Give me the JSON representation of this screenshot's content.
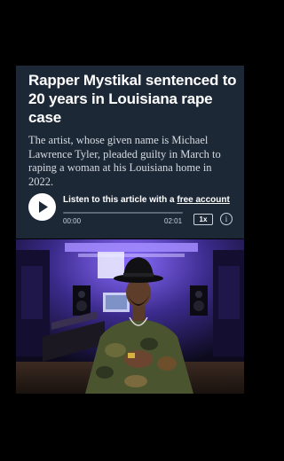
{
  "article": {
    "headline": "Rapper Mystikal sentenced to 20 years in Louisiana rape case",
    "summary": "The artist, whose given name is Michael Lawrence Tyler, pleaded guilty in March to raping a woman at his Louisiana home in 2022."
  },
  "audio_player": {
    "listen_prefix": "Listen to this article with a ",
    "listen_link": "free account",
    "current_time": "00:00",
    "total_time": "02:01",
    "speed": "1x",
    "info_glyph": "i",
    "progress": 0,
    "play_icon": "play-icon"
  },
  "colors": {
    "page_background": "#000000",
    "card_background": "#1d2837",
    "headline_text": "#ffffff",
    "summary_text": "#d6dbe2",
    "accent_light": "#ffffff",
    "studio_light": "#6a4bd6"
  },
  "photo": {
    "subject": "man in camouflage jacket and fedora seated in purple-lit recording studio"
  }
}
